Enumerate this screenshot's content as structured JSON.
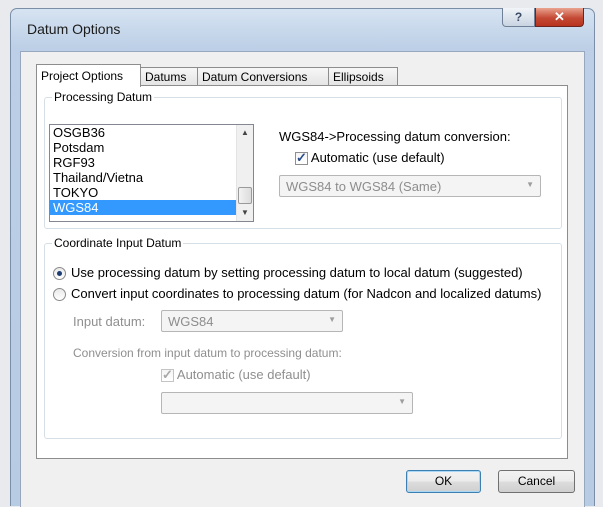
{
  "window": {
    "title": "Datum Options",
    "help_label": "?",
    "close_label": "✕"
  },
  "tabs": [
    {
      "label": "Project Options"
    },
    {
      "label": "Datums"
    },
    {
      "label": "Datum Conversions"
    },
    {
      "label": "Ellipsoids"
    }
  ],
  "processing_datum": {
    "legend": "Processing Datum",
    "items": [
      "OSGB36",
      "Potsdam",
      "RGF93",
      "Thailand/Vietna",
      "TOKYO",
      "WGS84"
    ],
    "selected": "WGS84",
    "conversion_label": "WGS84->Processing datum conversion:",
    "automatic_label": "Automatic (use default)",
    "automatic_checked": true,
    "conversion_value": "WGS84 to WGS84 (Same)"
  },
  "coordinate_input": {
    "legend": "Coordinate Input Datum",
    "option1_label": "Use processing datum by setting processing datum to local datum (suggested)",
    "option2_label": "Convert input coordinates to processing datum (for Nadcon and localized datums)",
    "selected_option": 1,
    "input_datum_label": "Input datum:",
    "input_datum_value": "WGS84",
    "conversion_label": "Conversion from input datum to processing datum:",
    "automatic_label": "Automatic (use default)",
    "automatic_checked": true,
    "conversion_value": ""
  },
  "buttons": {
    "ok": "OK",
    "cancel": "Cancel"
  }
}
